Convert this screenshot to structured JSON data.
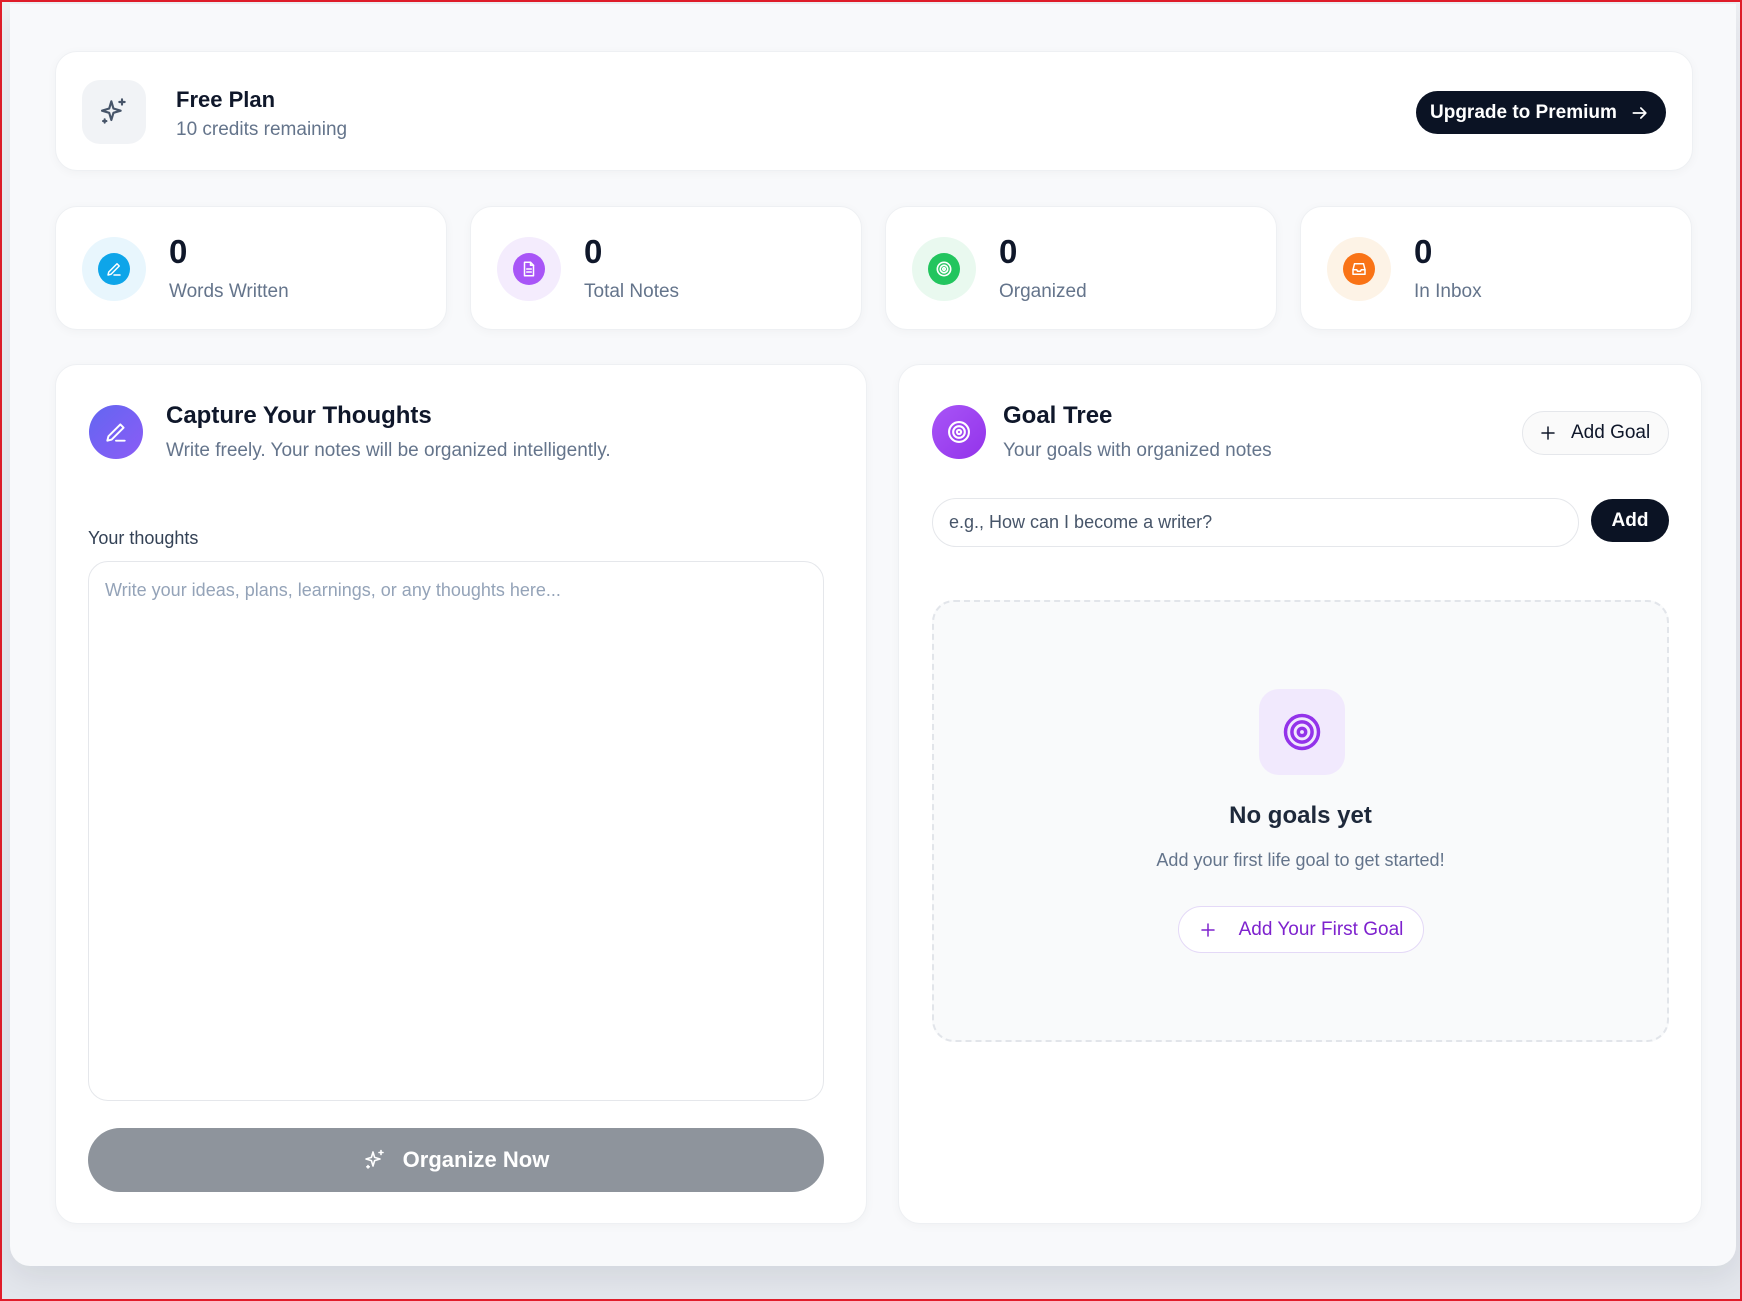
{
  "plan": {
    "title": "Free Plan",
    "credits": "10 credits remaining",
    "upgrade_label": "Upgrade to Premium",
    "icon": "sparkles-icon"
  },
  "stats": [
    {
      "value": "0",
      "label": "Words Written",
      "icon": "pencil-icon",
      "color": "#0ea5e9",
      "bg": "#e8f6fd"
    },
    {
      "value": "0",
      "label": "Total Notes",
      "icon": "document-icon",
      "color": "#a855f7",
      "bg": "#f4ecfd"
    },
    {
      "value": "0",
      "label": "Organized",
      "icon": "target-icon",
      "color": "#22c55e",
      "bg": "#e9f9ef"
    },
    {
      "value": "0",
      "label": "In Inbox",
      "icon": "inbox-icon",
      "color": "#f97316",
      "bg": "#fdf3e6"
    }
  ],
  "capture": {
    "title": "Capture Your Thoughts",
    "subtitle": "Write freely. Your notes will be organized intelligently.",
    "label": "Your thoughts",
    "placeholder": "Write your ideas, plans, learnings, or any thoughts here...",
    "value": "",
    "organize_label": "Organize Now"
  },
  "goals": {
    "title": "Goal Tree",
    "subtitle": "Your goals with organized notes",
    "add_goal_label": "Add Goal",
    "input_placeholder": "e.g., How can I become a writer?",
    "add_label": "Add",
    "empty_title": "No goals yet",
    "empty_subtitle": "Add your first life goal to get started!",
    "first_goal_label": "Add Your First Goal"
  },
  "colors": {
    "primary_dark": "#0b1324",
    "accent_purple": "#9333ea",
    "muted_button": "#8e949c"
  }
}
